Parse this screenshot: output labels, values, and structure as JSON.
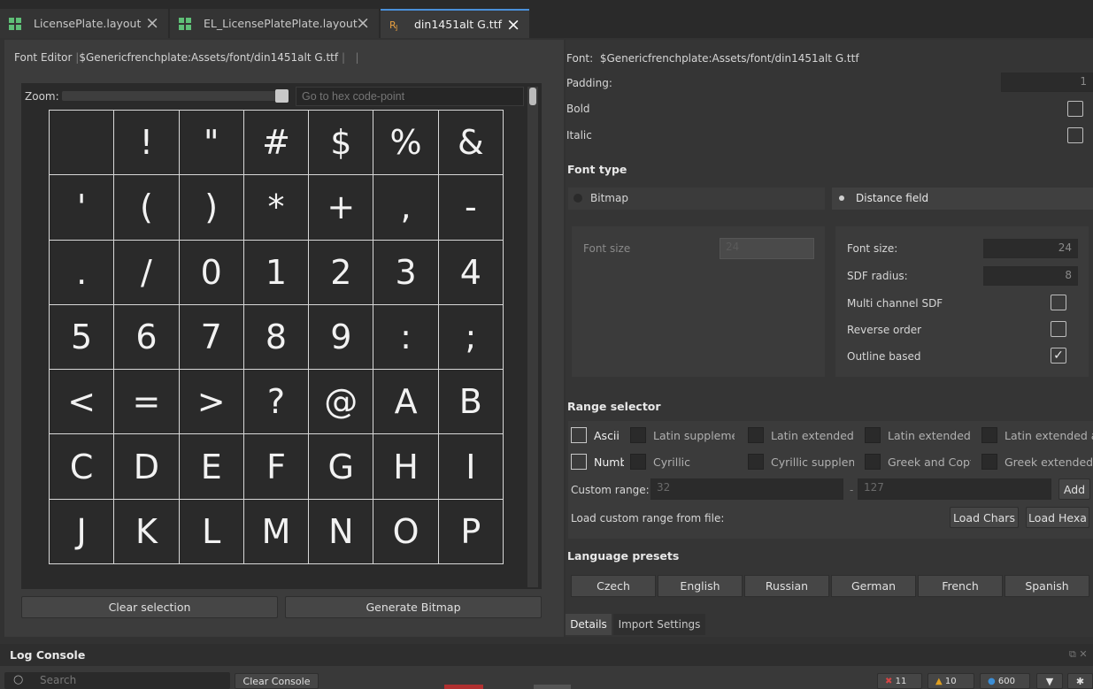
{
  "tabs": [
    {
      "label": "LicensePlate.layout",
      "icon": "layout-icon"
    },
    {
      "label": "EL_LicensePlatePlate.layout",
      "icon": "layout-icon"
    },
    {
      "label": "din1451alt G.ttf",
      "icon": "font-file-icon"
    }
  ],
  "font_editor": {
    "title": "Font Editor",
    "path": "$Genericfrenchplate:Assets/font/din1451alt G.ttf",
    "zoom_label": "Zoom:",
    "hex_placeholder": "Go to hex code-point",
    "glyphs": [
      " ",
      "!",
      "\"",
      "#",
      "$",
      "%",
      "&",
      "'",
      "(",
      ")",
      "*",
      "+",
      ",",
      "-",
      ".",
      "/",
      "0",
      "1",
      "2",
      "3",
      "4",
      "5",
      "6",
      "7",
      "8",
      "9",
      ":",
      ";",
      "<",
      "=",
      ">",
      "?",
      "@",
      "A",
      "B",
      "C",
      "D",
      "E",
      "F",
      "G",
      "H",
      "I",
      "J",
      "K",
      "L",
      "M",
      "N",
      "O",
      "P"
    ],
    "clear_selection": "Clear selection",
    "generate_bitmap": "Generate Bitmap"
  },
  "details": {
    "font_label": "Font:",
    "font_path": "$Genericfrenchplate:Assets/font/din1451alt G.ttf",
    "padding_label": "Padding:",
    "padding_value": "1",
    "bold_label": "Bold",
    "italic_label": "Italic",
    "font_type_title": "Font type",
    "bitmap_label": "Bitmap",
    "distance_field_label": "Distance field",
    "bitmap_font_size_label": "Font size",
    "bitmap_font_size_value": "24",
    "df_font_size_label": "Font size:",
    "df_font_size_value": "24",
    "sdf_radius_label": "SDF radius:",
    "sdf_radius_value": "8",
    "multi_channel_label": "Multi channel SDF",
    "reverse_order_label": "Reverse order",
    "outline_based_label": "Outline based",
    "range_selector_title": "Range selector",
    "range_row1": [
      {
        "label": "Ascii",
        "enabled": true
      },
      {
        "label": "Latin supplement",
        "enabled": false
      },
      {
        "label": "Latin extended A",
        "enabled": false
      },
      {
        "label": "Latin extended",
        "enabled": false
      },
      {
        "label": "Latin extended add",
        "enabled": false
      }
    ],
    "range_row2": [
      {
        "label": "Numbers",
        "enabled": true
      },
      {
        "label": "Cyrillic",
        "enabled": false
      },
      {
        "label": "Cyrillic supplement",
        "enabled": false
      },
      {
        "label": "Greek and Coptic",
        "enabled": false
      },
      {
        "label": "Greek extended",
        "enabled": false
      }
    ],
    "custom_range_label": "Custom range:",
    "custom_range_from": "32",
    "custom_range_dash": "-",
    "custom_range_to": "127",
    "add_button": "Add",
    "load_custom_label": "Load custom range from file:",
    "load_chars_button": "Load Chars",
    "load_hexa_button": "Load Hexa",
    "language_presets_title": "Language presets",
    "language_presets": [
      "Czech",
      "English",
      "Russian",
      "German",
      "French",
      "Spanish"
    ],
    "bottom_tabs": [
      "Details",
      "Import Settings"
    ]
  },
  "console": {
    "title": "Log Console",
    "search_placeholder": "Search",
    "clear_button": "Clear Console",
    "error_count": "11",
    "warning_count": "10",
    "info_count": "600"
  },
  "colors": {
    "accent": "#4a90d9",
    "error": "#d64545",
    "warning": "#e0a020",
    "info": "#3b8ed6"
  }
}
